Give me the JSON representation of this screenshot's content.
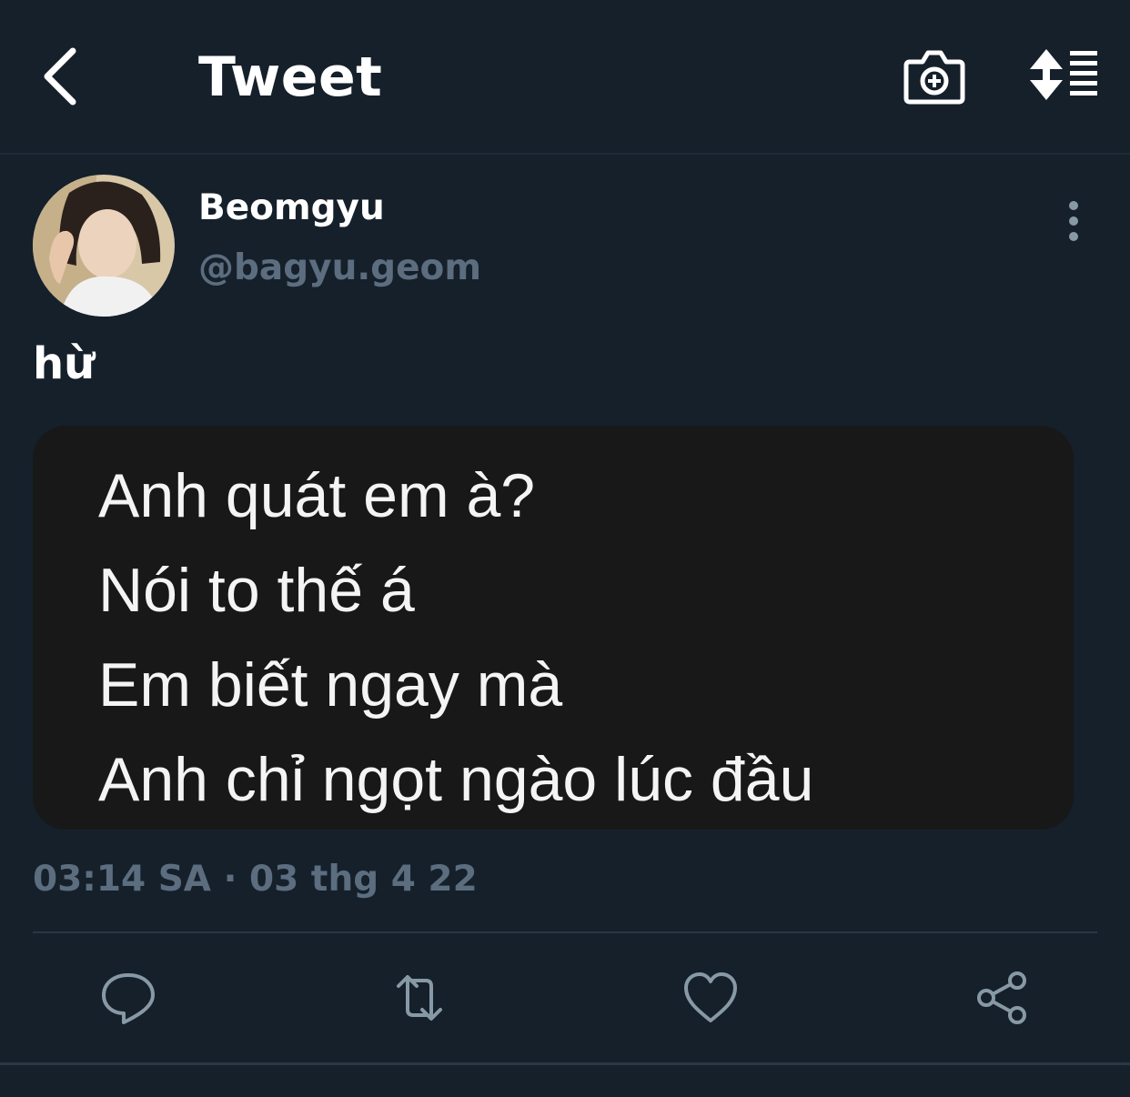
{
  "header": {
    "title": "Tweet",
    "back_icon": "chevron-left-icon",
    "camera_icon": "camera-add-icon",
    "sort_icon": "sort-list-icon"
  },
  "tweet": {
    "author": {
      "display_name": "Beomgyu",
      "handle": "@bagyu.geom"
    },
    "text": "hừ",
    "media_lines": [
      "Anh quát em à?",
      "Nói to thế á",
      "Em biết ngay mà",
      "Anh chỉ ngọt ngào lúc đầu"
    ],
    "timestamp": "03:14 SA · 03 thg 4 22"
  },
  "actions": [
    {
      "icon": "reply-icon"
    },
    {
      "icon": "retweet-icon"
    },
    {
      "icon": "like-icon"
    },
    {
      "icon": "share-icon"
    }
  ],
  "colors": {
    "background": "#15202b",
    "secondary_text": "#5b6d7e",
    "divider": "#2a3744",
    "media_background": "#181818"
  }
}
